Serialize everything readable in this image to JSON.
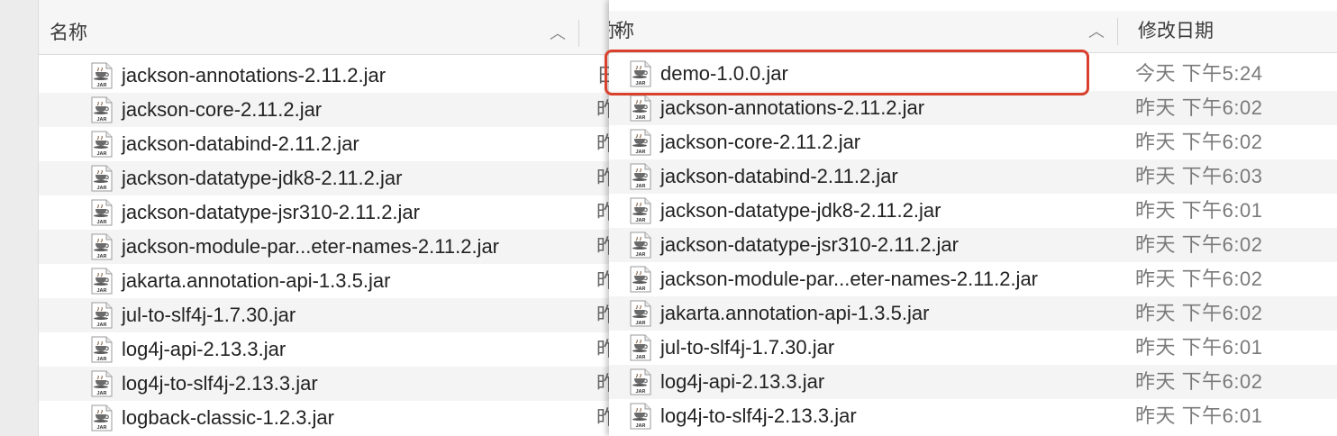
{
  "left_window": {
    "header": {
      "name_label": "名称"
    },
    "clipped_date_prefixes": [
      "日",
      "昨",
      "昨",
      "昨",
      "昨",
      "昨",
      "昨",
      "昨",
      "昨",
      "昨",
      "昨"
    ],
    "files": [
      "jackson-annotations-2.11.2.jar",
      "jackson-core-2.11.2.jar",
      "jackson-databind-2.11.2.jar",
      "jackson-datatype-jdk8-2.11.2.jar",
      "jackson-datatype-jsr310-2.11.2.jar",
      "jackson-module-par...eter-names-2.11.2.jar",
      "jakarta.annotation-api-1.3.5.jar",
      "jul-to-slf4j-1.7.30.jar",
      "log4j-api-2.13.3.jar",
      "log4j-to-slf4j-2.13.3.jar",
      "logback-classic-1.2.3.jar"
    ]
  },
  "right_window": {
    "header": {
      "name_label": "称",
      "name_prefix_clipped": "你",
      "date_label": "修改日期"
    },
    "files": [
      {
        "name": "demo-1.0.0.jar",
        "modified": "今天 下午5:24",
        "highlighted": true
      },
      {
        "name": "jackson-annotations-2.11.2.jar",
        "modified": "昨天 下午6:02"
      },
      {
        "name": "jackson-core-2.11.2.jar",
        "modified": "昨天 下午6:02"
      },
      {
        "name": "jackson-databind-2.11.2.jar",
        "modified": "昨天 下午6:03"
      },
      {
        "name": "jackson-datatype-jdk8-2.11.2.jar",
        "modified": "昨天 下午6:01"
      },
      {
        "name": "jackson-datatype-jsr310-2.11.2.jar",
        "modified": "昨天 下午6:02"
      },
      {
        "name": "jackson-module-par...eter-names-2.11.2.jar",
        "modified": "昨天 下午6:02"
      },
      {
        "name": "jakarta.annotation-api-1.3.5.jar",
        "modified": "昨天 下午6:02"
      },
      {
        "name": "jul-to-slf4j-1.7.30.jar",
        "modified": "昨天 下午6:01"
      },
      {
        "name": "log4j-api-2.13.3.jar",
        "modified": "昨天 下午6:02"
      },
      {
        "name": "log4j-to-slf4j-2.13.3.jar",
        "modified": "昨天 下午6:01"
      }
    ]
  },
  "icon": {
    "name": "jar-file-icon",
    "badge_text": "JAR"
  },
  "colors": {
    "highlight": "#d9412e",
    "row_alt": "#f4f4f4",
    "header_bg": "#f6f6f6",
    "date_text": "#7a7a7a"
  }
}
